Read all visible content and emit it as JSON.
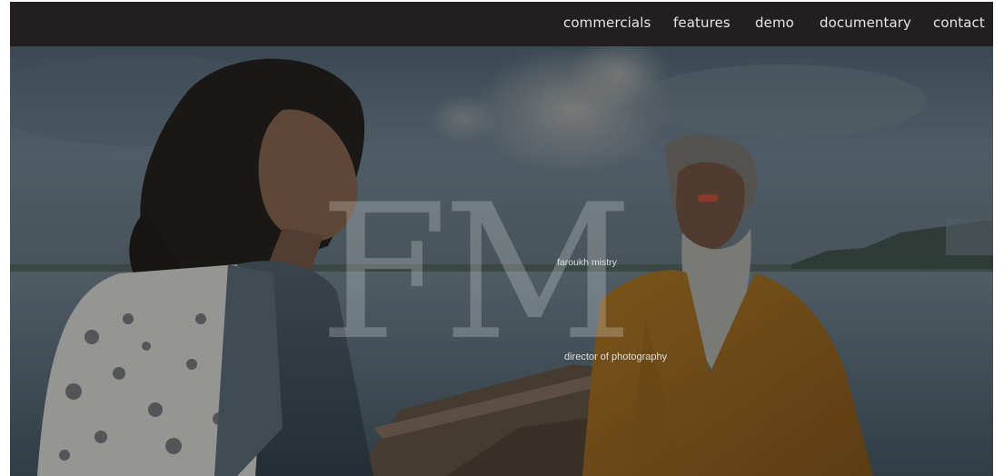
{
  "nav": {
    "items": [
      {
        "label": "commercials"
      },
      {
        "label": "features"
      },
      {
        "label": "demo"
      },
      {
        "label": "documentary"
      },
      {
        "label": "contact"
      }
    ]
  },
  "hero": {
    "logo_mark": "FM",
    "name": "faroukh mistry",
    "role": "director of photography"
  },
  "colors": {
    "navbar": "#231f20",
    "nav_text": "#e6e6e6",
    "sky": "#5b6b77",
    "water": "#4b5b66",
    "saffron_robe": "#a8701c"
  }
}
